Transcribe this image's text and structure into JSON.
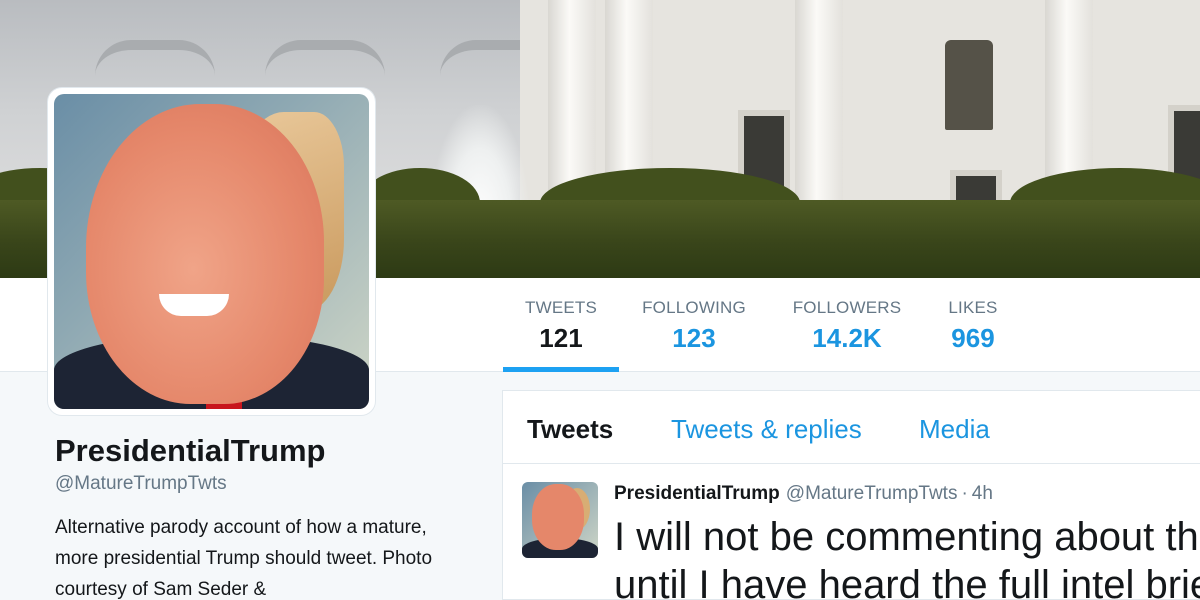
{
  "profile": {
    "name": "PresidentialTrump",
    "handle": "@MatureTrumpTwts",
    "bio": "Alternative parody account of how a mature, more presidential Trump should tweet. Photo courtesy of Sam Seder &"
  },
  "stats": [
    {
      "label": "TWEETS",
      "value": "121",
      "active": true
    },
    {
      "label": "FOLLOWING",
      "value": "123",
      "active": false
    },
    {
      "label": "FOLLOWERS",
      "value": "14.2K",
      "active": false
    },
    {
      "label": "LIKES",
      "value": "969",
      "active": false
    }
  ],
  "tabs": [
    {
      "label": "Tweets",
      "active": true
    },
    {
      "label": "Tweets & replies",
      "active": false
    },
    {
      "label": "Media",
      "active": false
    }
  ],
  "tweet": {
    "name": "PresidentialTrump",
    "handle": "@MatureTrumpTwts",
    "separator": "·",
    "time": "4h",
    "text_line1": "I will not be commenting about th",
    "text_line2": "until I have heard the full intel brie"
  },
  "colors": {
    "accent": "#1da1f2",
    "link": "#1b95e0",
    "muted": "#657786",
    "text": "#14171a"
  }
}
